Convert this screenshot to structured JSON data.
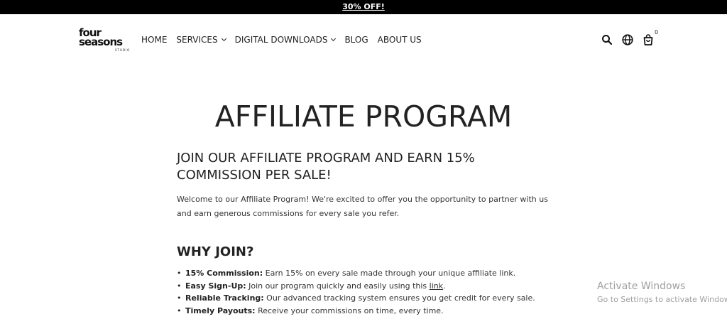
{
  "promo": {
    "text": "30% OFF!"
  },
  "logo": {
    "line1": "four",
    "line2": "seasons",
    "line3": "STUDIO"
  },
  "nav": {
    "items": [
      {
        "label": "HOME"
      },
      {
        "label": "SERVICES"
      },
      {
        "label": "DIGITAL DOWNLOADS"
      },
      {
        "label": "BLOG"
      },
      {
        "label": "ABOUT US"
      }
    ]
  },
  "header_icons": {
    "search": "search-icon",
    "language": "globe-icon",
    "cart": "cart-icon",
    "cart_count": "0"
  },
  "page": {
    "title": "AFFILIATE PROGRAM",
    "heading": "JOIN OUR AFFILIATE PROGRAM AND EARN 15% COMMISSION PER SALE!",
    "intro": "Welcome to our Affiliate Program! We're excited to offer you the opportunity to partner with us and earn generous commissions for every sale you refer.",
    "why_title": "WHY JOIN?",
    "benefits": [
      {
        "label": "15% Commission:",
        "text": " Earn 15% on every sale made through your unique affiliate link."
      },
      {
        "label": "Easy Sign-Up:",
        "text": " Join our program quickly and easily using this ",
        "link": "link",
        "after": "."
      },
      {
        "label": "Reliable Tracking:",
        "text": " Our advanced tracking system ensures you get credit for every sale."
      },
      {
        "label": "Timely Payouts:",
        "text": " Receive your commissions on time, every time."
      }
    ]
  },
  "watermark": {
    "title": "Activate Windows",
    "subtitle": "Go to Settings to activate Windows."
  }
}
